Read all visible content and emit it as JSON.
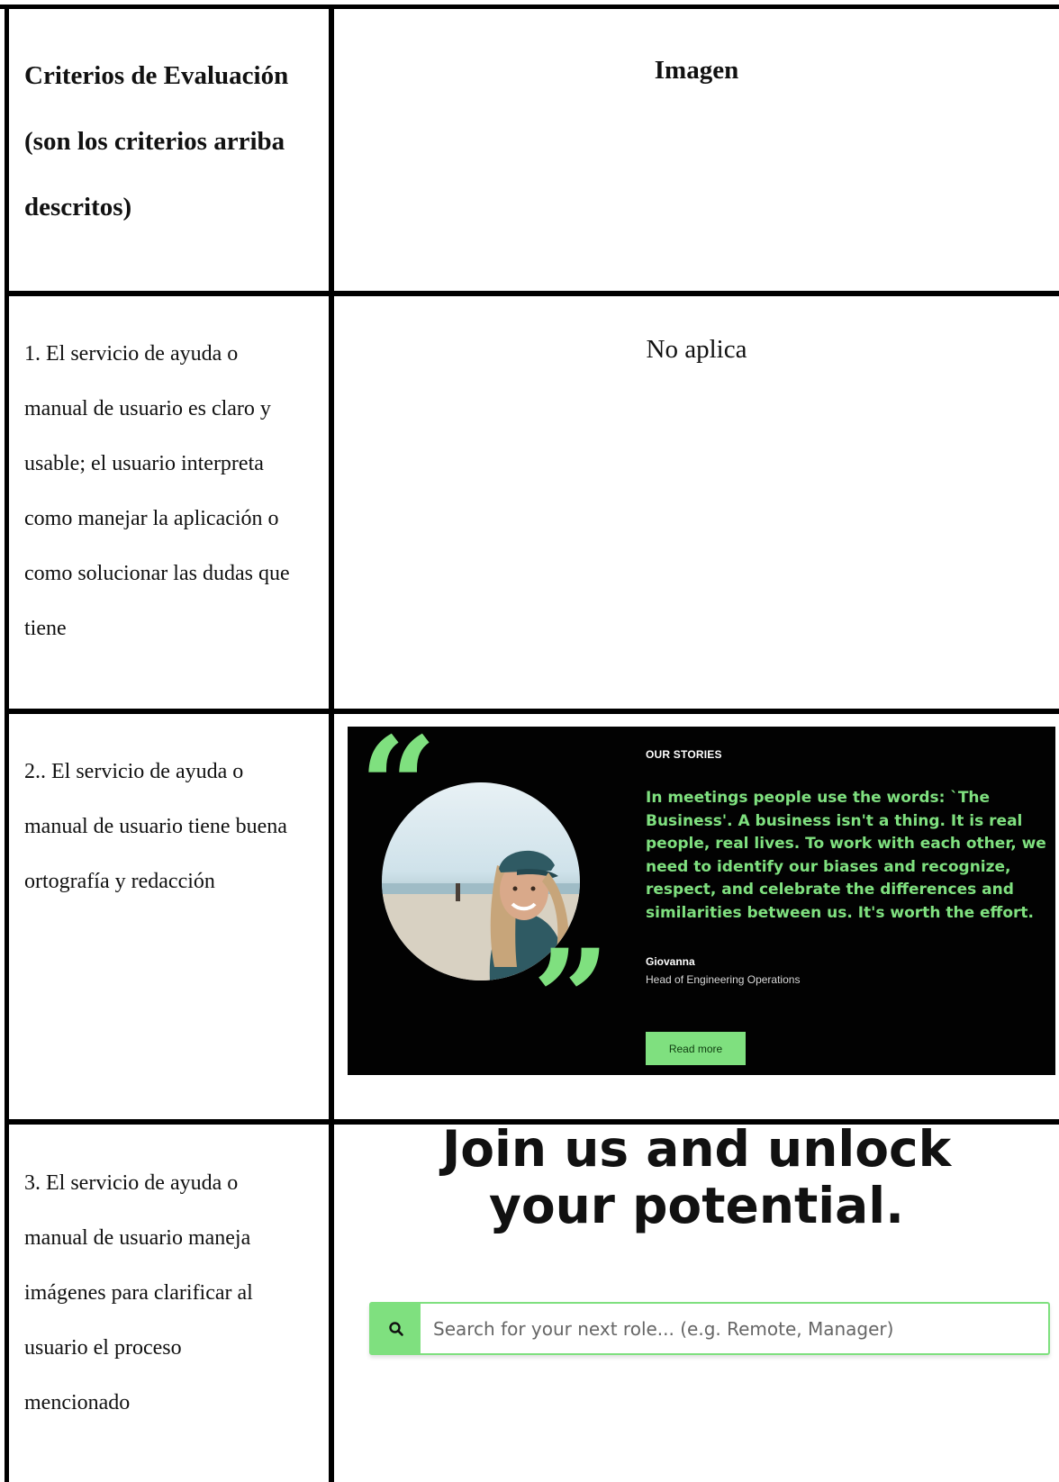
{
  "table": {
    "header": {
      "left": [
        "Criterios de Evaluación",
        "(son los criterios arriba",
        "descritos)"
      ],
      "right": "Imagen"
    },
    "rows": [
      {
        "criterion": [
          "1. El servicio de ayuda o",
          "manual de usuario es claro y",
          "usable; el usuario interpreta",
          "como manejar la aplicación o",
          "como solucionar las dudas que",
          "tiene"
        ],
        "image_text": "No aplica"
      },
      {
        "criterion": [
          "2.. El servicio de ayuda o",
          "manual de usuario tiene buena",
          "ortografía y redacción"
        ]
      },
      {
        "criterion": [
          "3. El servicio de ayuda o",
          "manual de usuario maneja",
          "imágenes para clarificar al",
          "usuario el proceso",
          "mencionado"
        ]
      }
    ]
  },
  "stories_card": {
    "eyebrow": "OUR STORIES",
    "quote_lines": [
      "In meetings people use the words: `The",
      "Business'. A business isn't a thing. It is real",
      "people, real lives. To work with each other, we",
      "need to identify our biases and recognize,",
      "respect, and celebrate the differences and",
      "similarities between us. It's worth the effort."
    ],
    "name": "Giovanna",
    "role": "Head of Engineering Operations",
    "button_label": "Read more",
    "accent_color": "#7fe07f",
    "background_color": "#020202"
  },
  "join_section": {
    "headline_lines": [
      "Join us and unlock",
      "your potential."
    ],
    "search_placeholder": "Search for your next role... (e.g. Remote, Manager)",
    "search_icon": "search-icon"
  }
}
